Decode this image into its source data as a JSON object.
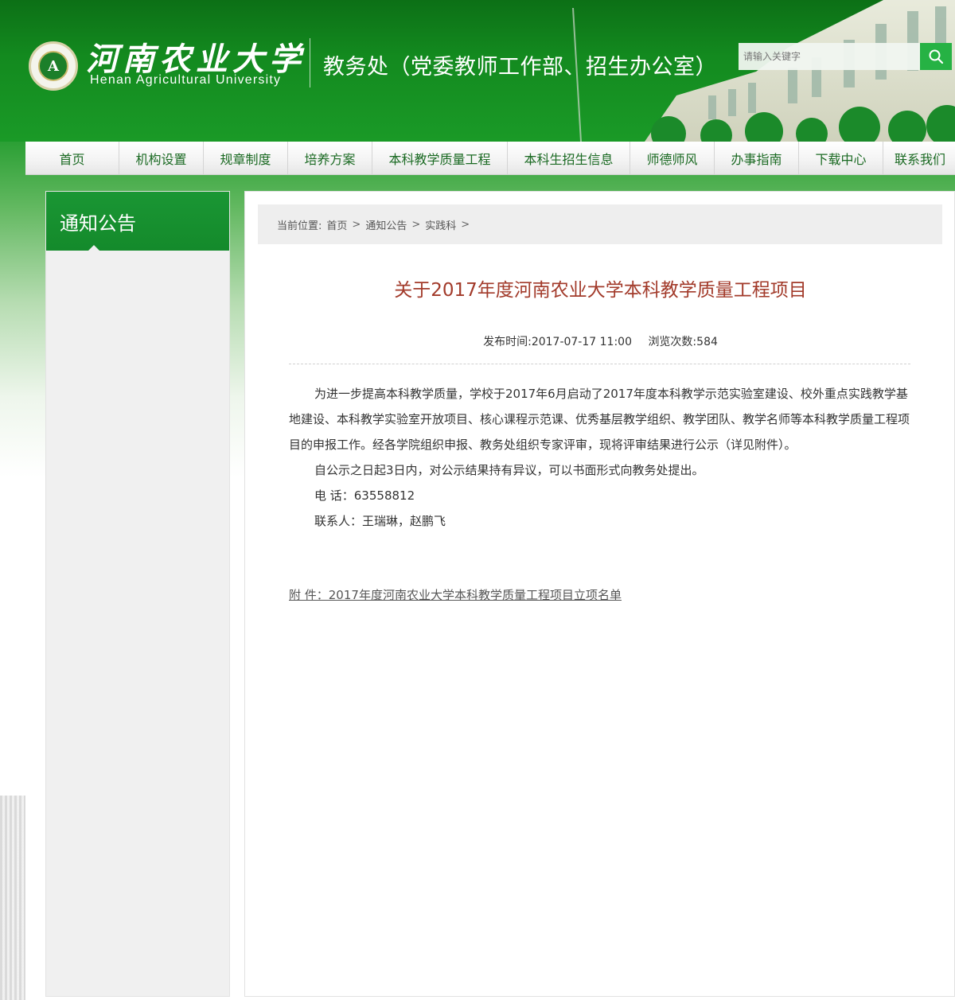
{
  "header": {
    "univ_cn": "河南农业大学",
    "univ_en": "Henan Agricultural University",
    "dept_title": "教务处（党委教师工作部、招生办公室）",
    "search_placeholder": "请输入关键字",
    "logo_glyph": "A"
  },
  "nav": {
    "items": [
      {
        "label": "首页"
      },
      {
        "label": "机构设置"
      },
      {
        "label": "规章制度"
      },
      {
        "label": "培养方案"
      },
      {
        "label": "本科教学质量工程"
      },
      {
        "label": "本科生招生信息"
      },
      {
        "label": "师德师风"
      },
      {
        "label": "办事指南"
      },
      {
        "label": "下载中心"
      },
      {
        "label": "联系我们"
      }
    ]
  },
  "sidebar": {
    "title": "通知公告"
  },
  "breadcrumb": {
    "prefix": "当前位置:",
    "items": [
      "首页",
      "通知公告",
      "实践科"
    ],
    "sep": ">"
  },
  "article": {
    "title": "关于2017年度河南农业大学本科教学质量工程项目",
    "publish_label": "发布时间:",
    "publish_time": "2017-07-17 11:00",
    "views_label": "浏览次数:",
    "views": "584",
    "paragraphs": [
      "为进一步提高本科教学质量，学校于2017年6月启动了2017年度本科教学示范实验室建设、校外重点实践教学基地建设、本科教学实验室开放项目、核心课程示范课、优秀基层教学组织、教学团队、教学名师等本科教学质量工程项目的申报工作。经各学院组织申报、教务处组织专家评审，现将评审结果进行公示（详见附件）。",
      "自公示之日起3日内，对公示结果持有异议，可以书面形式向教务处提出。",
      "电 话：63558812",
      "联系人：王瑞琳，赵鹏飞"
    ],
    "attachment": "附 件：2017年度河南农业大学本科教学质量工程项目立项名单"
  },
  "colors": {
    "brand_green": "#148a2b",
    "title_red": "#a23a2a",
    "nav_text": "#1b6a23"
  }
}
